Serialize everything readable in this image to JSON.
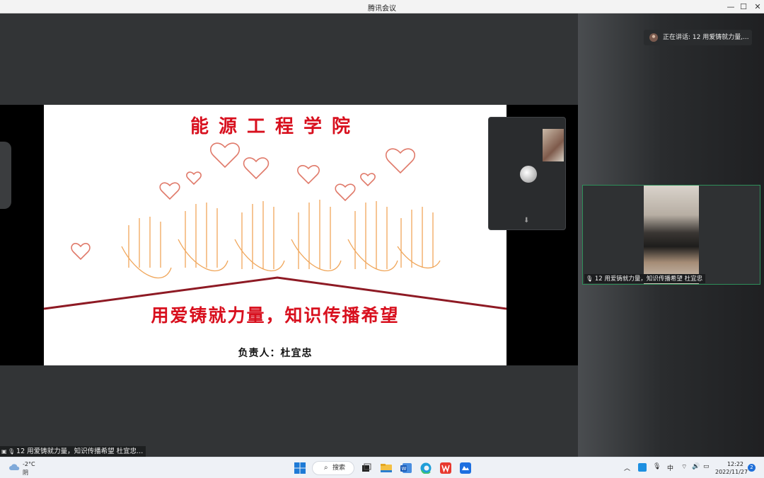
{
  "window": {
    "title": "腾讯会议"
  },
  "slide": {
    "heading": "能源工程学院",
    "slogan": "用爱铸就力量，知识传播希望",
    "owner": "负责人：杜宜忠"
  },
  "caption": {
    "text": "12 用爱铸就力量，知识传播希望 杜宜忠..."
  },
  "right_panel": {
    "speaking": "正在讲话: 12 用爱铸就力量,...",
    "participant_label": "12 用爱铸就力量，知识传播希望 杜宜忠"
  },
  "taskbar": {
    "weather_temp": "-2°C",
    "weather_cond": "阴",
    "search_label": "搜索",
    "ime": "中",
    "time": "12:22",
    "date": "2022/11/27",
    "notifications": "2"
  },
  "colors": {
    "accent_red": "#d8101e",
    "tile_border": "#2e8f5a"
  },
  "icons": [
    "minimize-icon",
    "maximize-icon",
    "close-icon",
    "microphone-icon",
    "screen-share-icon",
    "cloud-icon",
    "windows-start-icon",
    "search-icon",
    "task-view-icon",
    "file-explorer-icon",
    "word-icon",
    "edge-icon",
    "wps-icon",
    "meeting-app-icon",
    "chevron-up-icon",
    "wifi-icon",
    "volume-icon",
    "battery-icon"
  ]
}
